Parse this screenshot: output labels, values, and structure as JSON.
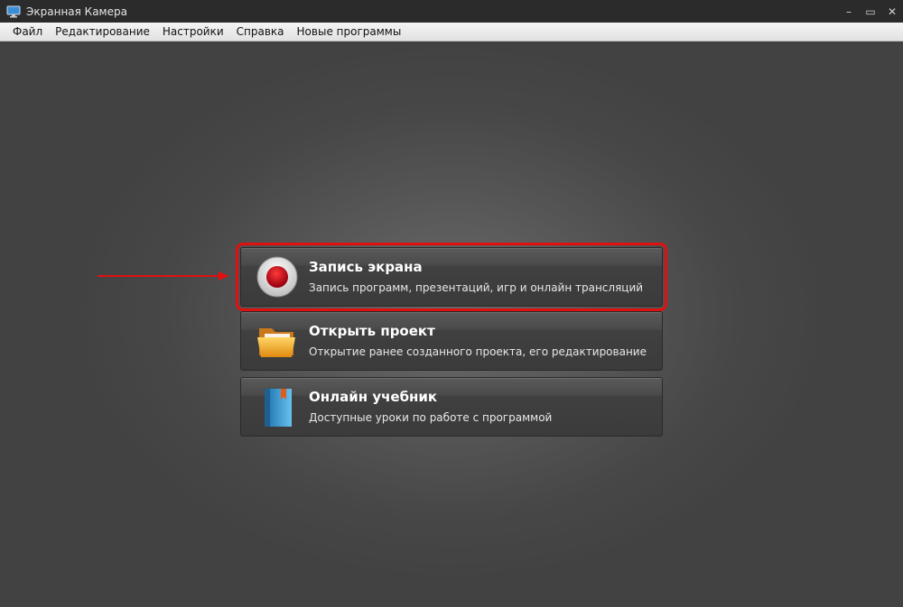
{
  "window": {
    "title": "Экранная Камера",
    "controls": [
      "–",
      "▭",
      "✕"
    ]
  },
  "menu": [
    "Файл",
    "Редактирование",
    "Настройки",
    "Справка",
    "Новые программы"
  ],
  "cards": [
    {
      "title": "Запись экрана",
      "description": "Запись программ, презентаций, игр и онлайн трансляций",
      "icon": "record-icon",
      "highlighted": true
    },
    {
      "title": "Открыть проект",
      "description": "Открытие ранее созданного проекта, его редактирование",
      "icon": "folder-icon",
      "highlighted": false
    },
    {
      "title": "Онлайн учебник",
      "description": "Доступные уроки по работе с программой",
      "icon": "book-icon",
      "highlighted": false
    }
  ],
  "colors": {
    "highlight": "#e01010",
    "record": "#c00010",
    "folder": "#f2a81d",
    "book": "#3aa0d8"
  }
}
